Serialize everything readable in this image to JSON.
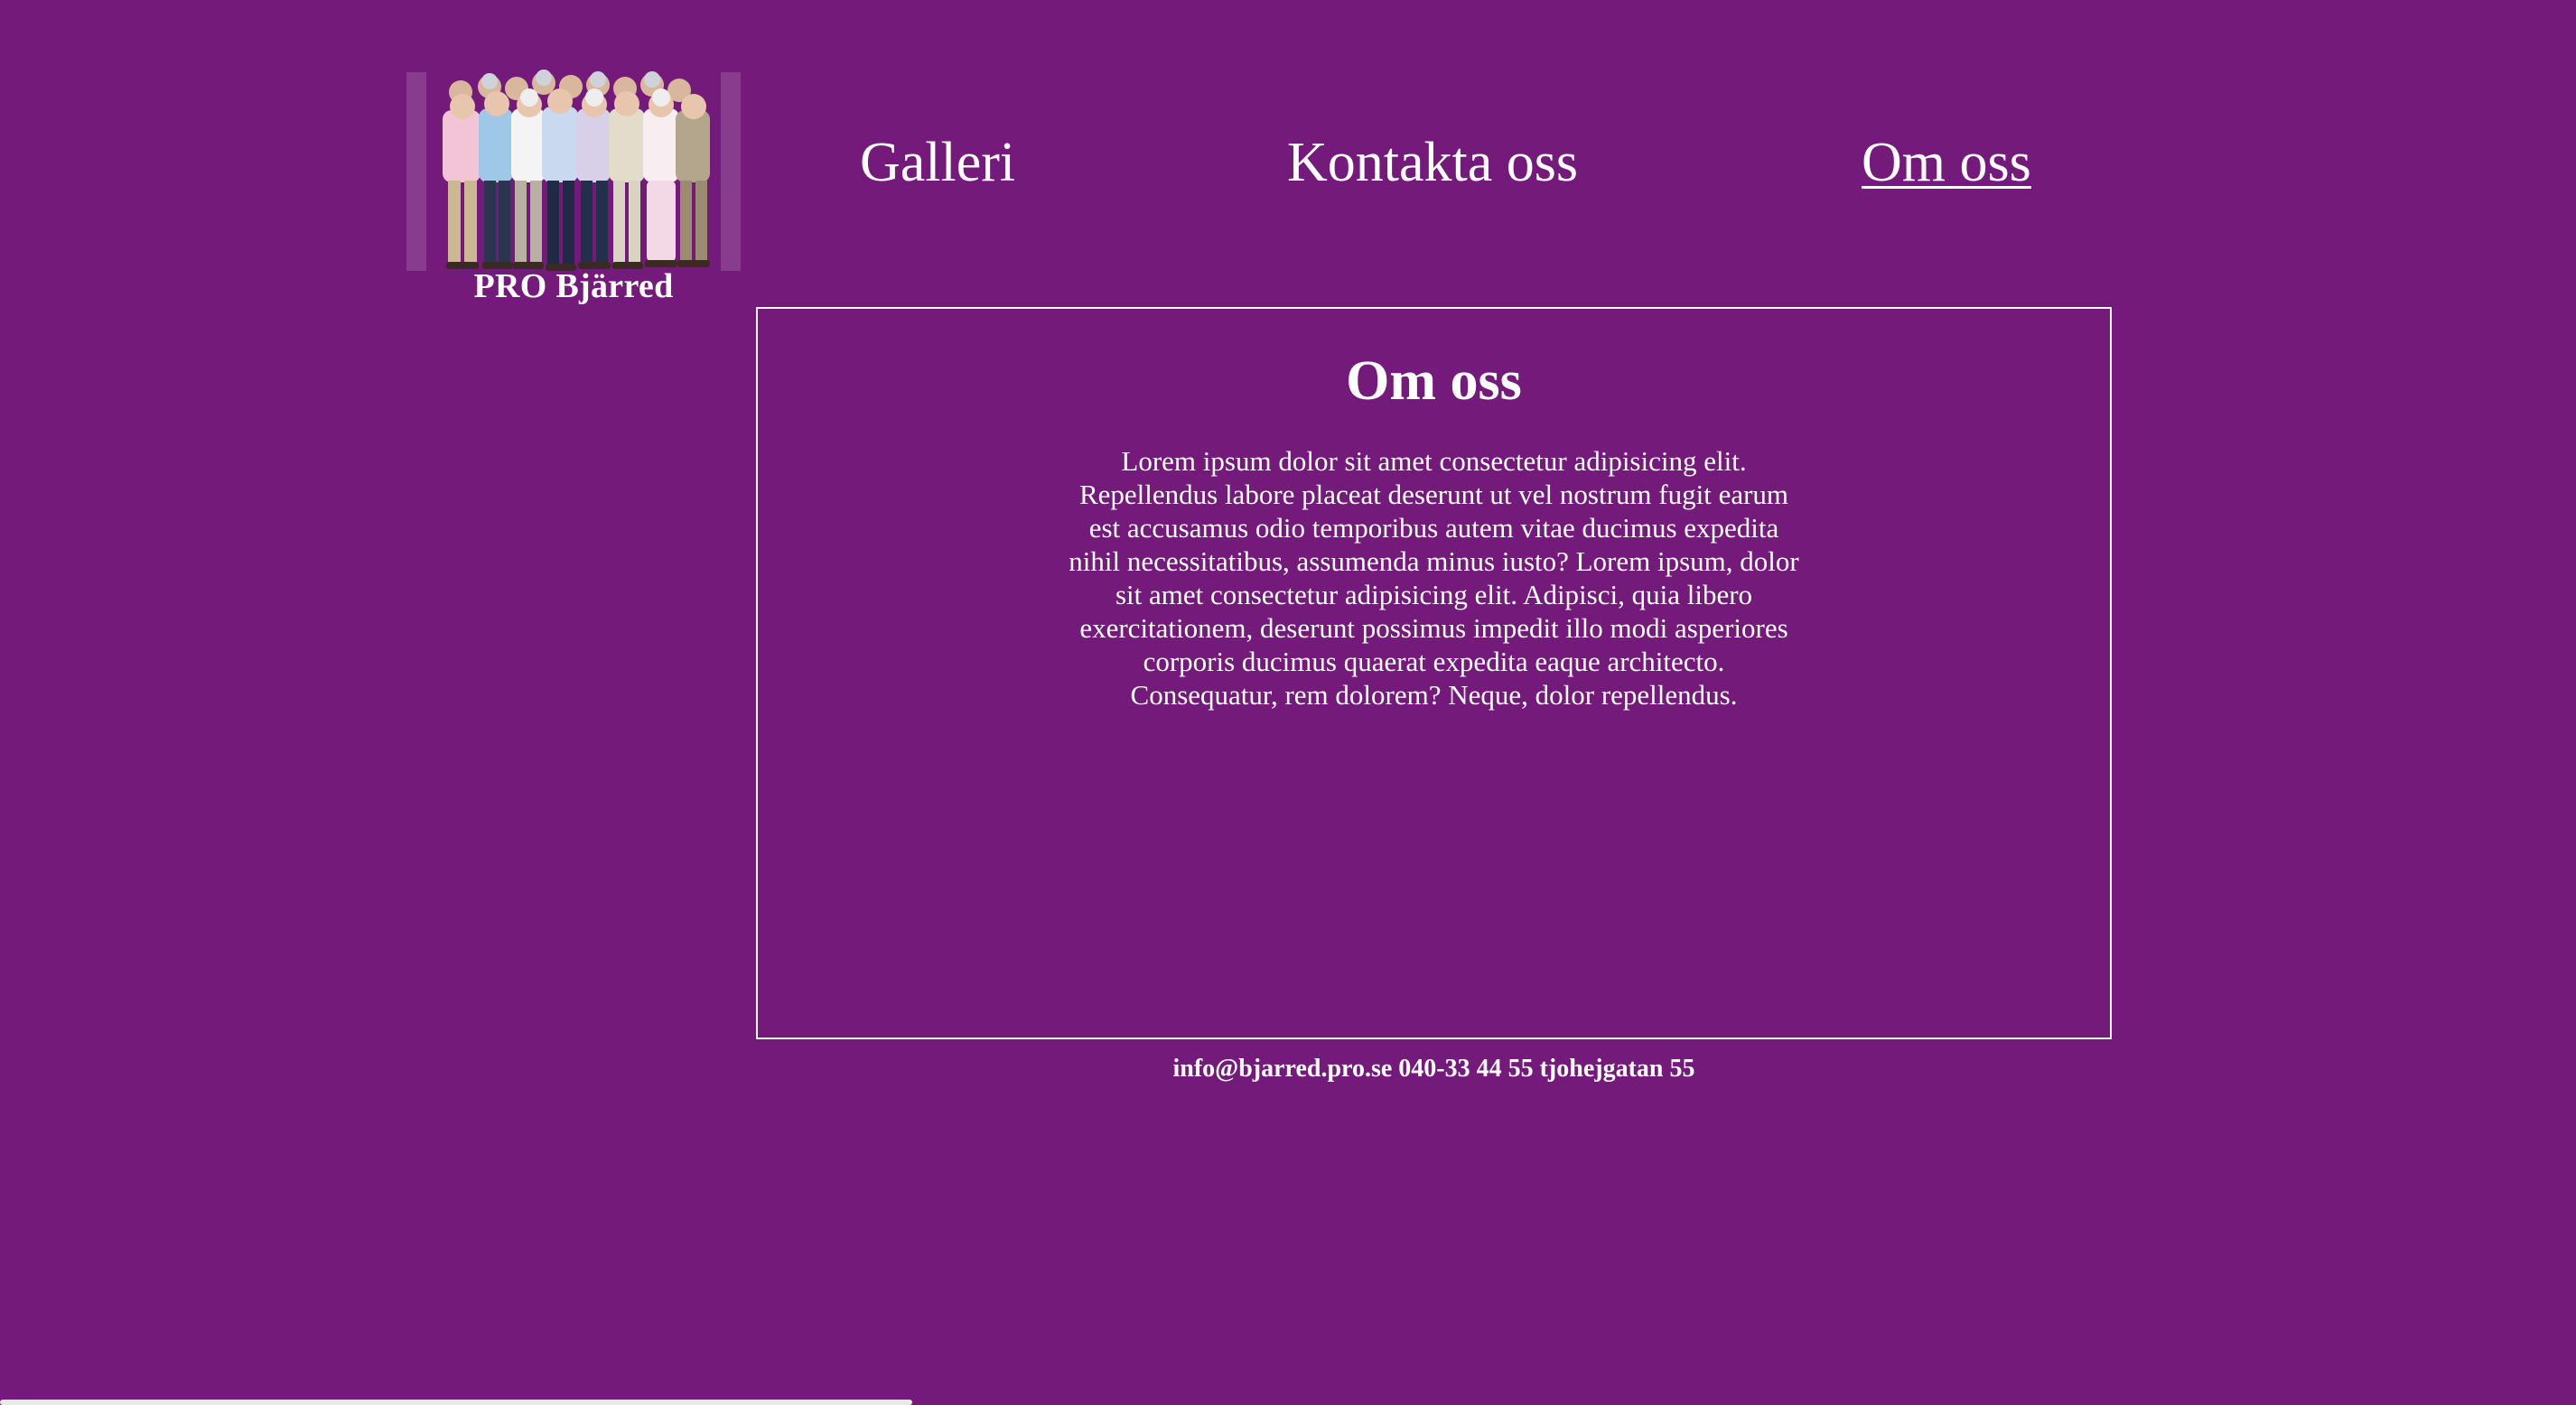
{
  "site": {
    "name": "PRO Bjärred",
    "logo_alt": "Group of seniors"
  },
  "nav": {
    "items": [
      {
        "label": "Galleri",
        "active": false
      },
      {
        "label": "Kontakta oss",
        "active": false
      },
      {
        "label": "Om oss",
        "active": true
      }
    ]
  },
  "main": {
    "title": "Om oss",
    "body_lines": [
      "Lorem ipsum dolor sit amet consectetur adipisicing elit.",
      "Repellendus labore placeat deserunt ut vel nostrum fugit earum",
      "est accusamus odio temporibus autem vitae ducimus expedita",
      "nihil necessitatibus, assumenda minus iusto? Lorem ipsum, dolor",
      "sit amet consectetur adipisicing elit. Adipisci, quia libero",
      "exercitationem, deserunt possimus impedit illo modi asperiores",
      "corporis ducimus quaerat expedita eaque architecto.",
      "Consequatur, rem dolorem? Neque, dolor repellendus."
    ]
  },
  "footer": {
    "text": "info@bjarred.pro.se 040-33 44 55 tjohejgatan 55"
  },
  "colors": {
    "background": "#741a7b",
    "text": "#ffffff"
  }
}
